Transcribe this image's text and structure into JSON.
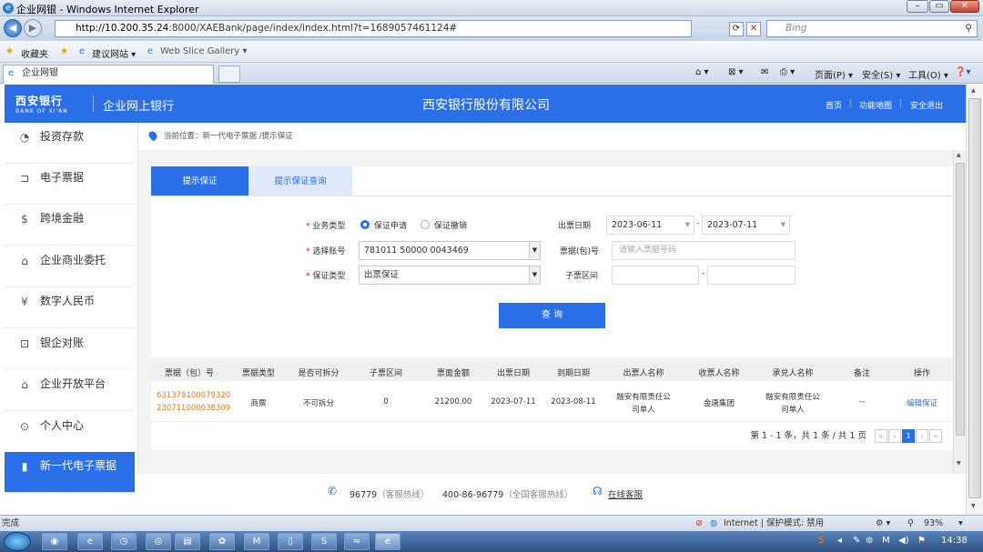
{
  "browser": {
    "title": "企业网银 - Windows Internet Explorer",
    "url_host": "http://10.200.35.24",
    "url_rest": ":8000/XAEBank/page/index/index.html?t=1689057461124#",
    "search_placeholder": "Bing",
    "favorites_label": "收藏夹",
    "fav_items": [
      "建议网站 ▾",
      "Web Slice Gallery ▾"
    ],
    "tab_label": "企业网银",
    "commands": [
      "页面(P) ▾",
      "安全(S) ▾",
      "工具(O) ▾"
    ]
  },
  "header": {
    "logo_cn": "西安银行",
    "logo_en": "BANK OF XI'AN",
    "bank_product": "企业网上银行",
    "company": "西安银行股份有限公司",
    "links": [
      "首页",
      "功能地图",
      "安全退出"
    ]
  },
  "sidebar": {
    "items": [
      {
        "label": "投资存款",
        "icon": "clock-icon",
        "glyph": "◔"
      },
      {
        "label": "电子票据",
        "icon": "bookmark-icon",
        "glyph": "⊐"
      },
      {
        "label": "跨境金融",
        "icon": "dollar-circle-icon",
        "glyph": "$"
      },
      {
        "label": "企业商业委托",
        "icon": "house-icon",
        "glyph": "⌂"
      },
      {
        "label": "数字人民币",
        "icon": "yuan-circle-icon",
        "glyph": "¥"
      },
      {
        "label": "银企对账",
        "icon": "chart-icon",
        "glyph": "⊡"
      },
      {
        "label": "企业开放平台",
        "icon": "house-icon",
        "glyph": "⌂"
      },
      {
        "label": "个人中心",
        "icon": "user-icon",
        "glyph": "⊙"
      },
      {
        "label": "新一代电子票据",
        "icon": "bookmark-icon",
        "glyph": "▮"
      }
    ]
  },
  "breadcrumb": "当前位置：新一代电子票据 /提示保证",
  "tabs": [
    "提示保证",
    "提示保证查询"
  ],
  "form": {
    "biz_type_label": "业务类型",
    "biz_type_options": [
      "保证申请",
      "保证撤销"
    ],
    "account_label": "选择账号",
    "account_value": "781011 50000 0043469",
    "guarantee_label": "保证类型",
    "guarantee_value": "出票保证",
    "date_label": "出票日期",
    "date_from": "2023-06-11",
    "date_to": "2023-07-11",
    "date_sep": "-",
    "bill_label": "票据(包)号",
    "bill_placeholder": "请输入票据号码",
    "sub_label": "子票区间",
    "sub_sep": "-",
    "query_button": "查 询"
  },
  "table": {
    "headers": [
      "票据（包）号",
      "票据类型",
      "是否可拆分",
      "子票区间",
      "票面金额",
      "出票日期",
      "到期日期",
      "出票人名称",
      "收票人名称",
      "承兑人名称",
      "备注",
      "操作"
    ],
    "row": {
      "bill_no_1": "631379100079320",
      "bill_no_2": "230711000038309",
      "type": "商票",
      "splittable": "不可拆分",
      "sub_range": "0",
      "amount": "21200.00",
      "issue_date": "2023-07-11",
      "due_date": "2023-08-11",
      "drawer_1": "融安有限责任公",
      "drawer_2": "司单人",
      "payee": "金唐集团",
      "acceptor_1": "融安有限责任公",
      "acceptor_2": "司单人",
      "remark": "--",
      "action": "编辑保证"
    },
    "pager_text": "第 1 - 1 条，共 1 条 / 共 1 页",
    "current_page": "1"
  },
  "footer": {
    "hotline_num": "96779",
    "hotline_desc": "（客服热线）",
    "national_num": "400-86-96779",
    "national_desc": "（全国客服热线）",
    "online_service": "在线客服"
  },
  "statusbar": {
    "left": "完成",
    "zone": "Internet | 保护模式: 禁用",
    "zoom": "93%"
  },
  "taskbar": {
    "clock": "14:38",
    "apps": [
      "chrome",
      "ie",
      "app3",
      "app4",
      "folder",
      "app6",
      "M",
      "app8",
      "S",
      "app10",
      "ie"
    ]
  }
}
